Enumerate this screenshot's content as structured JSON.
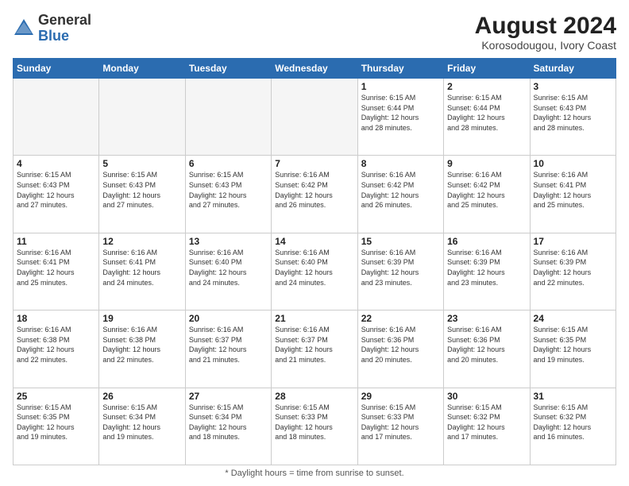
{
  "header": {
    "logo_general": "General",
    "logo_blue": "Blue",
    "month_year": "August 2024",
    "location": "Korosodougou, Ivory Coast"
  },
  "footer": {
    "note": "Daylight hours"
  },
  "weekdays": [
    "Sunday",
    "Monday",
    "Tuesday",
    "Wednesday",
    "Thursday",
    "Friday",
    "Saturday"
  ],
  "weeks": [
    [
      {
        "day": "",
        "info": "",
        "empty": true
      },
      {
        "day": "",
        "info": "",
        "empty": true
      },
      {
        "day": "",
        "info": "",
        "empty": true
      },
      {
        "day": "",
        "info": "",
        "empty": true
      },
      {
        "day": "1",
        "info": "Sunrise: 6:15 AM\nSunset: 6:44 PM\nDaylight: 12 hours\nand 28 minutes.",
        "empty": false
      },
      {
        "day": "2",
        "info": "Sunrise: 6:15 AM\nSunset: 6:44 PM\nDaylight: 12 hours\nand 28 minutes.",
        "empty": false
      },
      {
        "day": "3",
        "info": "Sunrise: 6:15 AM\nSunset: 6:43 PM\nDaylight: 12 hours\nand 28 minutes.",
        "empty": false
      }
    ],
    [
      {
        "day": "4",
        "info": "Sunrise: 6:15 AM\nSunset: 6:43 PM\nDaylight: 12 hours\nand 27 minutes.",
        "empty": false
      },
      {
        "day": "5",
        "info": "Sunrise: 6:15 AM\nSunset: 6:43 PM\nDaylight: 12 hours\nand 27 minutes.",
        "empty": false
      },
      {
        "day": "6",
        "info": "Sunrise: 6:15 AM\nSunset: 6:43 PM\nDaylight: 12 hours\nand 27 minutes.",
        "empty": false
      },
      {
        "day": "7",
        "info": "Sunrise: 6:16 AM\nSunset: 6:42 PM\nDaylight: 12 hours\nand 26 minutes.",
        "empty": false
      },
      {
        "day": "8",
        "info": "Sunrise: 6:16 AM\nSunset: 6:42 PM\nDaylight: 12 hours\nand 26 minutes.",
        "empty": false
      },
      {
        "day": "9",
        "info": "Sunrise: 6:16 AM\nSunset: 6:42 PM\nDaylight: 12 hours\nand 25 minutes.",
        "empty": false
      },
      {
        "day": "10",
        "info": "Sunrise: 6:16 AM\nSunset: 6:41 PM\nDaylight: 12 hours\nand 25 minutes.",
        "empty": false
      }
    ],
    [
      {
        "day": "11",
        "info": "Sunrise: 6:16 AM\nSunset: 6:41 PM\nDaylight: 12 hours\nand 25 minutes.",
        "empty": false
      },
      {
        "day": "12",
        "info": "Sunrise: 6:16 AM\nSunset: 6:41 PM\nDaylight: 12 hours\nand 24 minutes.",
        "empty": false
      },
      {
        "day": "13",
        "info": "Sunrise: 6:16 AM\nSunset: 6:40 PM\nDaylight: 12 hours\nand 24 minutes.",
        "empty": false
      },
      {
        "day": "14",
        "info": "Sunrise: 6:16 AM\nSunset: 6:40 PM\nDaylight: 12 hours\nand 24 minutes.",
        "empty": false
      },
      {
        "day": "15",
        "info": "Sunrise: 6:16 AM\nSunset: 6:39 PM\nDaylight: 12 hours\nand 23 minutes.",
        "empty": false
      },
      {
        "day": "16",
        "info": "Sunrise: 6:16 AM\nSunset: 6:39 PM\nDaylight: 12 hours\nand 23 minutes.",
        "empty": false
      },
      {
        "day": "17",
        "info": "Sunrise: 6:16 AM\nSunset: 6:39 PM\nDaylight: 12 hours\nand 22 minutes.",
        "empty": false
      }
    ],
    [
      {
        "day": "18",
        "info": "Sunrise: 6:16 AM\nSunset: 6:38 PM\nDaylight: 12 hours\nand 22 minutes.",
        "empty": false
      },
      {
        "day": "19",
        "info": "Sunrise: 6:16 AM\nSunset: 6:38 PM\nDaylight: 12 hours\nand 22 minutes.",
        "empty": false
      },
      {
        "day": "20",
        "info": "Sunrise: 6:16 AM\nSunset: 6:37 PM\nDaylight: 12 hours\nand 21 minutes.",
        "empty": false
      },
      {
        "day": "21",
        "info": "Sunrise: 6:16 AM\nSunset: 6:37 PM\nDaylight: 12 hours\nand 21 minutes.",
        "empty": false
      },
      {
        "day": "22",
        "info": "Sunrise: 6:16 AM\nSunset: 6:36 PM\nDaylight: 12 hours\nand 20 minutes.",
        "empty": false
      },
      {
        "day": "23",
        "info": "Sunrise: 6:16 AM\nSunset: 6:36 PM\nDaylight: 12 hours\nand 20 minutes.",
        "empty": false
      },
      {
        "day": "24",
        "info": "Sunrise: 6:15 AM\nSunset: 6:35 PM\nDaylight: 12 hours\nand 19 minutes.",
        "empty": false
      }
    ],
    [
      {
        "day": "25",
        "info": "Sunrise: 6:15 AM\nSunset: 6:35 PM\nDaylight: 12 hours\nand 19 minutes.",
        "empty": false
      },
      {
        "day": "26",
        "info": "Sunrise: 6:15 AM\nSunset: 6:34 PM\nDaylight: 12 hours\nand 19 minutes.",
        "empty": false
      },
      {
        "day": "27",
        "info": "Sunrise: 6:15 AM\nSunset: 6:34 PM\nDaylight: 12 hours\nand 18 minutes.",
        "empty": false
      },
      {
        "day": "28",
        "info": "Sunrise: 6:15 AM\nSunset: 6:33 PM\nDaylight: 12 hours\nand 18 minutes.",
        "empty": false
      },
      {
        "day": "29",
        "info": "Sunrise: 6:15 AM\nSunset: 6:33 PM\nDaylight: 12 hours\nand 17 minutes.",
        "empty": false
      },
      {
        "day": "30",
        "info": "Sunrise: 6:15 AM\nSunset: 6:32 PM\nDaylight: 12 hours\nand 17 minutes.",
        "empty": false
      },
      {
        "day": "31",
        "info": "Sunrise: 6:15 AM\nSunset: 6:32 PM\nDaylight: 12 hours\nand 16 minutes.",
        "empty": false
      }
    ]
  ]
}
